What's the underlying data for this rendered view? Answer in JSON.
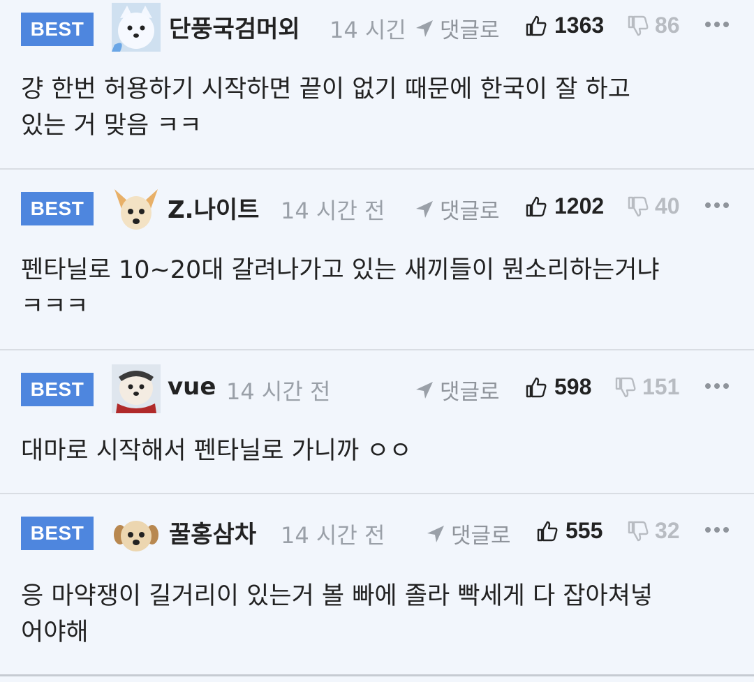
{
  "comments": [
    {
      "badge": "BEST",
      "avatar": "white-dog-avatar",
      "nickname": "단풍국검머외",
      "time": "14 시긴",
      "reply_label": "댓글로",
      "likes": "1363",
      "dislikes": "86",
      "body": "걍 한번 허용하기 시작하면 끝이 없기 때문에 한국이 잘 하고\n있는 거 맞음 ㅋㅋ"
    },
    {
      "badge": "BEST",
      "avatar": "chihuahua-avatar",
      "nickname": "Z.나이트",
      "time": "14 시간 전",
      "reply_label": "댓글로",
      "likes": "1202",
      "dislikes": "40",
      "body": "펜타닐로 10~20대 갈려나가고 있는 새끼들이 뭔소리하는거냐\nㅋㅋㅋ"
    },
    {
      "badge": "BEST",
      "avatar": "dog-red-scarf-avatar",
      "nickname": "vue",
      "time": "14 시간 전",
      "reply_label": "댓글로",
      "likes": "598",
      "dislikes": "151",
      "body": "대마로 시작해서 펜타닐로 가니까 ㅇㅇ"
    },
    {
      "badge": "BEST",
      "avatar": "puppy-avatar",
      "nickname": "꿀홍삼차",
      "time": "14 시간 전",
      "reply_label": "댓글로",
      "likes": "555",
      "dislikes": "32",
      "body": "응 마약쟁이 길거리이 있는거 볼 빠에 졸라 빡세게 다 잡아쳐넣\n어야해"
    }
  ],
  "colors": {
    "background": "#f2f6fc",
    "badge": "#4e86de",
    "divider": "#d9dde3",
    "muted": "#9aa0a8"
  }
}
